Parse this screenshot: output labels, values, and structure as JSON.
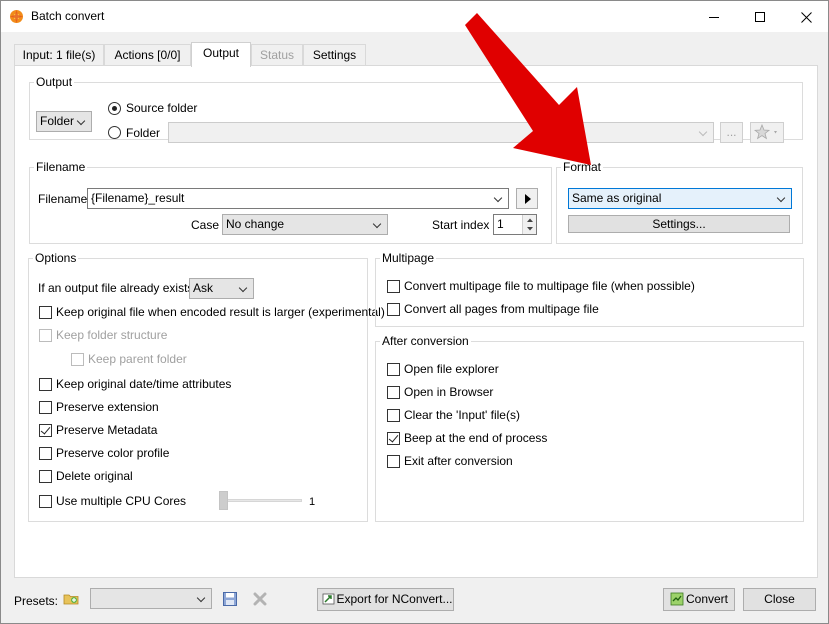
{
  "window": {
    "title": "Batch convert",
    "minimize": "—",
    "maximize": "☐",
    "close": "✕"
  },
  "tabs": [
    {
      "label": "Input: 1 file(s)"
    },
    {
      "label": "Actions [0/0]"
    },
    {
      "label": "Output"
    },
    {
      "label": "Status"
    },
    {
      "label": "Settings"
    }
  ],
  "output": {
    "group_label": "Output",
    "type_value": "Folder",
    "source_folder_label": "Source folder",
    "folder_label": "Folder",
    "folder_value": "",
    "browse_label": "...",
    "favorites_icon": "star-icon"
  },
  "filename": {
    "group_label": "Filename",
    "filename_label": "Filename",
    "filename_value": "{Filename}_result",
    "case_label": "Case",
    "case_value": "No change",
    "start_index_label": "Start index",
    "start_index_value": "1"
  },
  "format": {
    "group_label": "Format",
    "value": "Same as original",
    "settings_label": "Settings..."
  },
  "options": {
    "group_label": "Options",
    "exists_label": "If an output file already exists",
    "exists_value": "Ask",
    "items": [
      {
        "label": "Keep original file when encoded result is larger (experimental)",
        "checked": false
      },
      {
        "label": "Keep folder structure",
        "checked": false,
        "disabled": true
      },
      {
        "label": "Keep parent folder",
        "checked": false,
        "disabled": true
      },
      {
        "label": "Keep original date/time attributes",
        "checked": false
      },
      {
        "label": "Preserve extension",
        "checked": false
      },
      {
        "label": "Preserve Metadata",
        "checked": true
      },
      {
        "label": "Preserve color profile",
        "checked": false
      },
      {
        "label": "Delete original",
        "checked": false
      }
    ],
    "cpu_label": "Use multiple CPU Cores",
    "cpu_value": "1"
  },
  "multipage": {
    "group_label": "Multipage",
    "items": [
      {
        "label": "Convert multipage file to multipage file (when possible)"
      },
      {
        "label": "Convert all pages from multipage file"
      }
    ]
  },
  "after": {
    "group_label": "After conversion",
    "items": [
      {
        "label": "Open file explorer"
      },
      {
        "label": "Open in Browser"
      },
      {
        "label": "Clear the 'Input' file(s)"
      },
      {
        "label": "Beep at the end of process"
      },
      {
        "label": "Exit after conversion"
      }
    ]
  },
  "bottom": {
    "presets_label": "Presets:",
    "presets_value": "",
    "export_label": "Export for NConvert...",
    "convert_label": "Convert",
    "close_label": "Close"
  },
  "colors": {
    "accent": "#0078d7",
    "arrow": "#e00000"
  }
}
